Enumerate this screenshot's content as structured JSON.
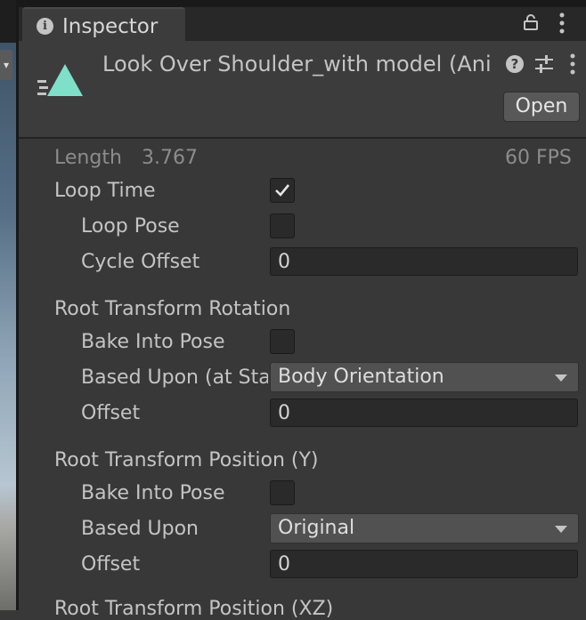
{
  "tab": {
    "title": "Inspector"
  },
  "header": {
    "clip_name": "Look Over Shoulder_with model (Animation)",
    "open_label": "Open"
  },
  "length_row": {
    "label": "Length",
    "value": "3.767",
    "fps": "60 FPS"
  },
  "loop_time": {
    "label": "Loop Time",
    "checked": true
  },
  "loop_pose": {
    "label": "Loop Pose",
    "checked": false
  },
  "cycle_offset": {
    "label": "Cycle Offset",
    "value": "0"
  },
  "root_rotation": {
    "heading": "Root Transform Rotation",
    "bake_label": "Bake Into Pose",
    "based_upon_label": "Based Upon (at Start)",
    "based_upon_value": "Body Orientation",
    "offset_label": "Offset",
    "offset_value": "0"
  },
  "root_position_y": {
    "heading": "Root Transform Position (Y)",
    "bake_label": "Bake Into Pose",
    "based_upon_label": "Based Upon",
    "based_upon_value": "Original",
    "offset_label": "Offset",
    "offset_value": "0"
  },
  "root_position_xz": {
    "heading": "Root Transform Position (XZ)"
  },
  "colors": {
    "accent_icon": "#7ee0c8",
    "panel": "#383838",
    "field": "#2a2a2a"
  }
}
